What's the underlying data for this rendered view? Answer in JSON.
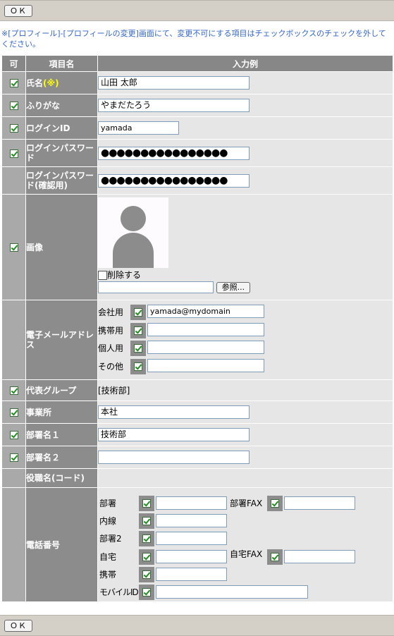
{
  "top_ok": "ＯＫ",
  "bottom_ok": "ＯＫ",
  "notice": "※[プロフィール]-[プロフィールの変更]画面にて、変更不可にする項目はチェックボックスのチェックを外してください。",
  "headers": {
    "col1": "可",
    "col2": "項目名",
    "col3": "入力例"
  },
  "rows": {
    "name": {
      "label": "氏名",
      "req": "(※)",
      "value": "山田 太郎",
      "checked": true
    },
    "kana": {
      "label": "ふりがな",
      "value": "やまだたろう",
      "checked": true
    },
    "login_id": {
      "label": "ログインID",
      "value": "yamada",
      "checked": true
    },
    "password": {
      "label": "ログインパスワード",
      "value": "●●●●●●●●●●●●●●●●",
      "checked": true
    },
    "password_confirm": {
      "label": "ログインパスワード(確認用)",
      "value": "●●●●●●●●●●●●●●●●"
    },
    "image": {
      "label": "画像",
      "checked": true,
      "delete_label": "削除する",
      "browse_label": "参照..."
    },
    "email": {
      "label": "電子メールアドレス",
      "items": [
        {
          "label": "会社用",
          "value": "yamada@mydomain",
          "checked": true
        },
        {
          "label": "携帯用",
          "value": "",
          "checked": true
        },
        {
          "label": "個人用",
          "value": "",
          "checked": true
        },
        {
          "label": "その他",
          "value": "",
          "checked": true
        }
      ]
    },
    "group": {
      "label": "代表グループ",
      "value": "[技術部]",
      "checked": true
    },
    "office": {
      "label": "事業所",
      "value": "本社",
      "checked": true
    },
    "dept1": {
      "label": "部署名１",
      "value": "技術部",
      "checked": true
    },
    "dept2": {
      "label": "部署名２",
      "value": "",
      "checked": true
    },
    "position": {
      "label": "役職名(コード)"
    },
    "phone": {
      "label": "電話番号",
      "dept": "部署",
      "dept_fax": "部署FAX",
      "ext": "内線",
      "dept2": "部署2",
      "home": "自宅",
      "home_fax": "自宅FAX",
      "mobile": "携帯",
      "mobile_id": "モバイルID"
    }
  }
}
